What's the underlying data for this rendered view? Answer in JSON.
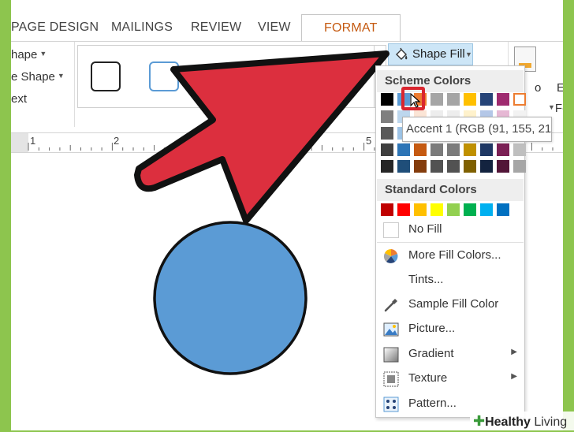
{
  "ribbon": {
    "tabs": [
      {
        "label": "PAGE DESIGN"
      },
      {
        "label": "MAILINGS"
      },
      {
        "label": "REVIEW"
      },
      {
        "label": "VIEW"
      },
      {
        "label": "FORMAT"
      }
    ],
    "left_group": {
      "edit_shape": "hape",
      "change_shape": "e Shape",
      "text": "ext"
    },
    "shape_fill_label": "Shape Fill",
    "right_partial_1": "o",
    "right_partial_2": "E",
    "right_partial_3": "Fo"
  },
  "ruler": {
    "numbers": [
      "1",
      "2",
      "5"
    ]
  },
  "dropdown": {
    "scheme_header": "Scheme Colors",
    "scheme_top_row": [
      "#000000",
      "#5b9bd5",
      "#ed7d31",
      "#a5a5a5",
      "#a5a5a5",
      "#ffc000",
      "#264478",
      "#9e2a6f",
      "#ffffff"
    ],
    "tooltip": "Accent 1 (RGB (91, 155, 213))",
    "standard_header": "Standard Colors",
    "standard_colors": [
      "#c00000",
      "#ff0000",
      "#ffc000",
      "#ffff00",
      "#92d050",
      "#00b050",
      "#00b0f0",
      "#0070c0"
    ],
    "no_fill": "No Fill",
    "items": [
      {
        "label": "More Fill Colors...",
        "icon": "color-wheel-icon"
      },
      {
        "label": "Tints...",
        "icon": ""
      },
      {
        "label": "Sample Fill Color",
        "icon": "eyedropper-icon"
      },
      {
        "label": "Picture...",
        "icon": "picture-icon"
      },
      {
        "label": "Gradient",
        "icon": "gradient-icon",
        "submenu": true
      },
      {
        "label": "Texture",
        "icon": "texture-icon",
        "submenu": true
      },
      {
        "label": "Pattern...",
        "icon": "pattern-icon"
      }
    ]
  },
  "colors": {
    "accent": "#c55a11",
    "arrow_red": "#dc2f3e",
    "circle_blue": "#5b9bd5",
    "background_green": "#8dc54e"
  },
  "watermark": {
    "brand_bold": "Healthy",
    "brand_light": "Living"
  }
}
